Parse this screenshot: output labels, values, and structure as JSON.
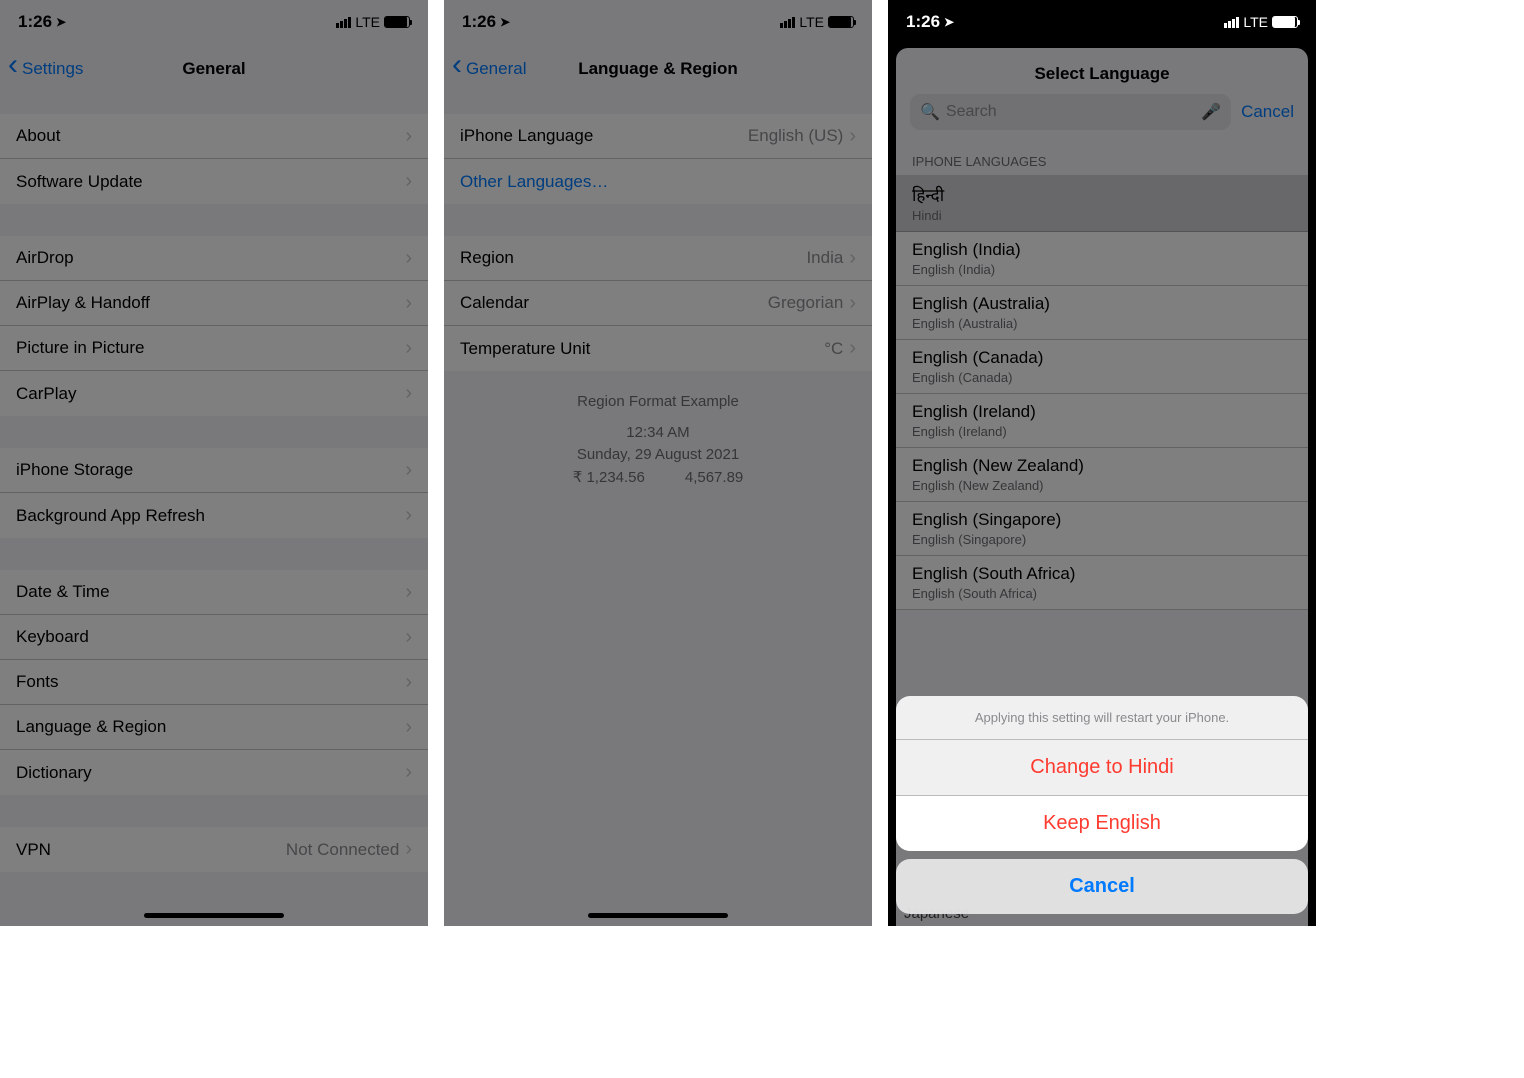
{
  "status": {
    "time": "1:26",
    "net": "LTE"
  },
  "p1": {
    "back": "Settings",
    "title": "General",
    "g1": [
      "About",
      "Software Update"
    ],
    "g2": [
      "AirDrop",
      "AirPlay & Handoff",
      "Picture in Picture",
      "CarPlay"
    ],
    "g3": [
      "iPhone Storage",
      "Background App Refresh"
    ],
    "g4": [
      "Date & Time",
      "Keyboard",
      "Fonts",
      "Language & Region",
      "Dictionary"
    ],
    "g5_label": "VPN",
    "g5_value": "Not Connected"
  },
  "p2": {
    "back": "General",
    "title": "Language & Region",
    "r1_label": "iPhone Language",
    "r1_value": "English (US)",
    "r2": "Other Languages…",
    "r3_label": "Region",
    "r3_value": "India",
    "r4_label": "Calendar",
    "r4_value": "Gregorian",
    "r5_label": "Temperature Unit",
    "r5_value": "°C",
    "ex_title": "Region Format Example",
    "ex_time": "12:34 AM",
    "ex_date": "Sunday, 29 August 2021",
    "ex_n1": "₹ 1,234.56",
    "ex_n2": "4,567.89"
  },
  "p3": {
    "title": "Select Language",
    "search_ph": "Search",
    "cancel": "Cancel",
    "section": "IPHONE LANGUAGES",
    "langs": [
      {
        "n": "हिन्दी",
        "e": "Hindi"
      },
      {
        "n": "English (India)",
        "e": "English (India)"
      },
      {
        "n": "English (Australia)",
        "e": "English (Australia)"
      },
      {
        "n": "English (Canada)",
        "e": "English (Canada)"
      },
      {
        "n": "English (Ireland)",
        "e": "English (Ireland)"
      },
      {
        "n": "English (New Zealand)",
        "e": "English (New Zealand)"
      },
      {
        "n": "English (Singapore)",
        "e": "English (Singapore)"
      },
      {
        "n": "English (South Africa)",
        "e": "English (South Africa)"
      }
    ],
    "peek": "Japanese",
    "sheet_msg": "Applying this setting will restart your iPhone.",
    "sheet_change": "Change to Hindi",
    "sheet_keep": "Keep English",
    "sheet_cancel": "Cancel"
  }
}
